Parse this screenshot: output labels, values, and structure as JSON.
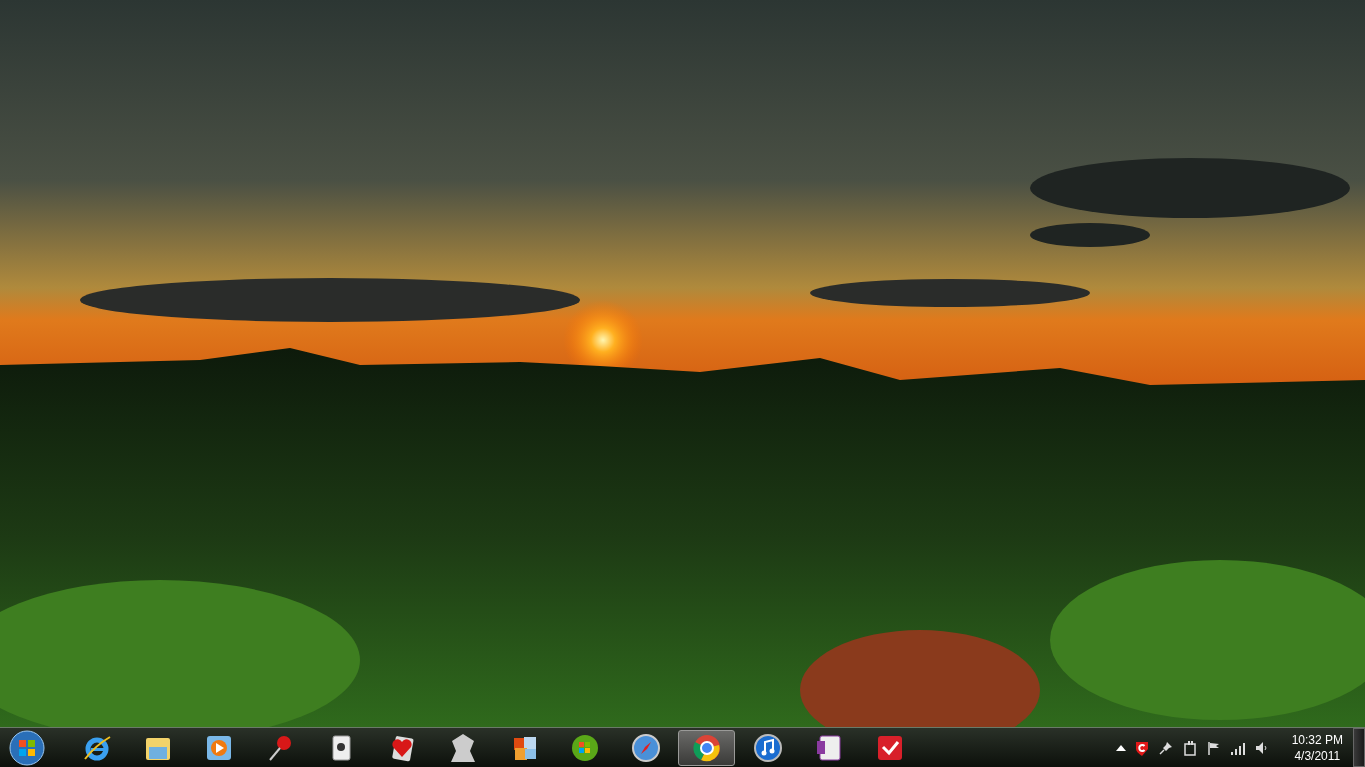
{
  "taskbar": {
    "pinned_apps": [
      {
        "selected": false
      },
      {
        "selected": false
      },
      {
        "selected": false
      },
      {
        "selected": false
      },
      {
        "selected": false
      },
      {
        "selected": false
      },
      {
        "selected": false
      },
      {
        "selected": false
      },
      {
        "selected": false
      },
      {
        "selected": false
      },
      {
        "selected": true
      },
      {
        "selected": false
      },
      {
        "selected": false
      },
      {
        "selected": false
      }
    ],
    "clock": {
      "time": "10:32 PM",
      "date": "4/3/2011"
    }
  }
}
